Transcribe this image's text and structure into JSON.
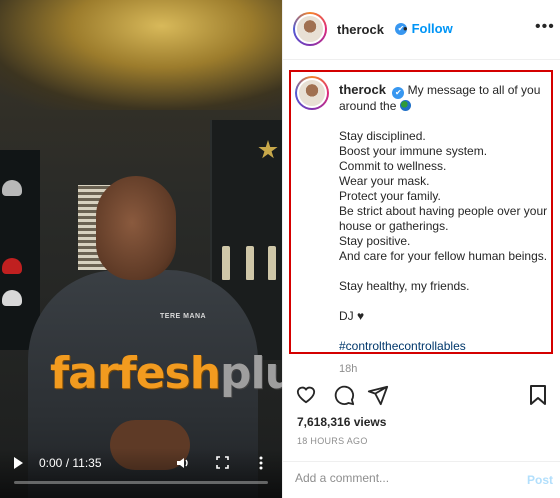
{
  "video": {
    "current_time": "0:00",
    "duration": "11:35",
    "time_separator": " / ",
    "progress_fraction": 0,
    "hoodie_text": "TERE MANA",
    "watermark_part1": "farfesh",
    "watermark_part2": "plus.com",
    "icons": [
      "play-icon",
      "volume-icon",
      "fullscreen-icon",
      "more-vert-icon"
    ]
  },
  "header": {
    "username": "therock",
    "verified_icon": "verified-badge-icon",
    "separator": "•",
    "follow_label": "Follow",
    "more_label": "•••"
  },
  "caption": {
    "username": "therock",
    "lines": [
      "My message to all of you around the",
      "Stay disciplined.",
      "Boost your immune system.",
      "Commit to wellness.",
      "Wear your mask.",
      "Protect your family.",
      "Be strict about having people over your house or gatherings.",
      "Stay positive.",
      "And care for your fellow human beings.",
      "Stay healthy, my friends.",
      "DJ",
      "#controlthecontrollables"
    ],
    "emoji_globe": "globe-icon",
    "emoji_heart": "black-heart-icon",
    "time_ago": "18h"
  },
  "actions": {
    "icons": [
      "like-heart-icon",
      "comment-icon",
      "share-icon",
      "bookmark-icon"
    ]
  },
  "stats": {
    "views": "7,618,316 views",
    "date": "18 HOURS AGO"
  },
  "comment_box": {
    "placeholder": "Add a comment...",
    "post_label": "Post"
  },
  "colors": {
    "accent": "#0095f6",
    "highlight_border": "#d40000",
    "watermark_orange": "#f29b1f"
  }
}
